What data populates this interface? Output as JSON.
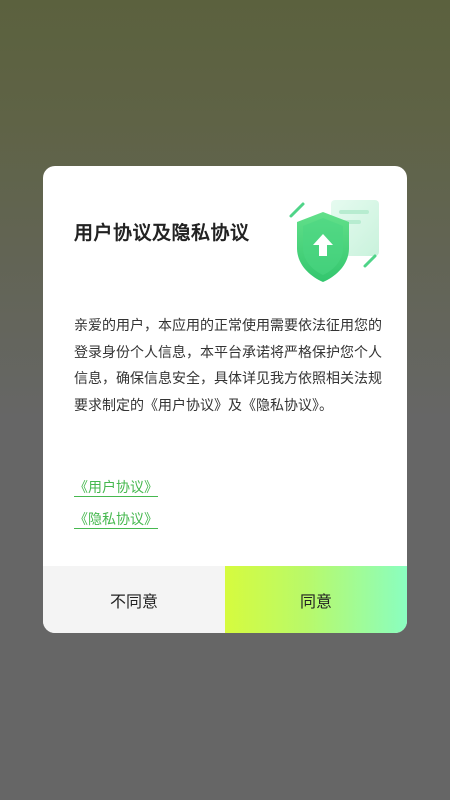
{
  "dialog": {
    "title": "用户协议及隐私协议",
    "body": "亲爱的用户，本应用的正常使用需要依法征用您的登录身份个人信息，本平台承诺将严格保护您个人信息，确保信息安全，具体详见我方依照相关法规要求制定的《用户协议》及《隐私协议》。",
    "links": {
      "user_agreement": "《用户协议》",
      "privacy_agreement": "《隐私协议》"
    },
    "buttons": {
      "disagree": "不同意",
      "agree": "同意"
    },
    "illustration_icon": "shield-upload-icon"
  },
  "colors": {
    "accent_green": "#46b84f",
    "agree_gradient_start": "#d6fb3e",
    "agree_gradient_end": "#8afec0",
    "disagree_bg": "#f4f4f4"
  }
}
